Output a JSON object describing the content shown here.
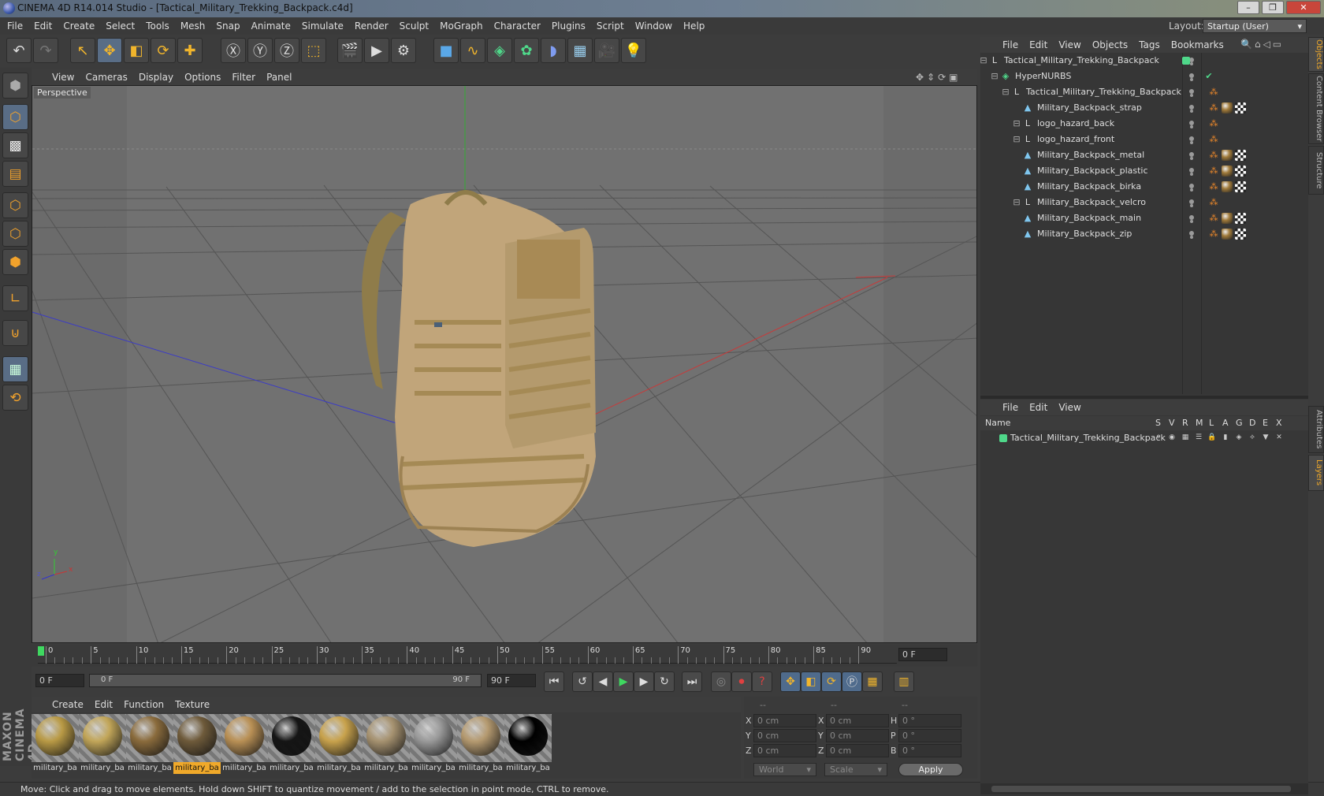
{
  "window": {
    "title": "CINEMA 4D R14.014 Studio - [Tactical_Military_Trekking_Backpack.c4d]",
    "layout_label": "Layout:",
    "layout_value": "Startup (User)"
  },
  "menubar": {
    "items": [
      "File",
      "Edit",
      "Create",
      "Select",
      "Tools",
      "Mesh",
      "Snap",
      "Animate",
      "Simulate",
      "Render",
      "Sculpt",
      "MoGraph",
      "Character",
      "Plugins",
      "Script",
      "Window",
      "Help"
    ]
  },
  "viewport": {
    "menu": [
      "View",
      "Cameras",
      "Display",
      "Options",
      "Filter",
      "Panel"
    ],
    "label": "Perspective",
    "axis_x": "x",
    "axis_y": "y",
    "axis_z": "z"
  },
  "timeline": {
    "ticks": [
      "0",
      "5",
      "10",
      "15",
      "20",
      "25",
      "30",
      "35",
      "40",
      "45",
      "50",
      "55",
      "60",
      "65",
      "70",
      "75",
      "80",
      "85",
      "90"
    ],
    "current_frame": "0 F",
    "start_field": "0 F",
    "range_start": "0 F",
    "range_end": "90 F",
    "end_field": "90 F"
  },
  "materials": {
    "menu": [
      "Create",
      "Edit",
      "Function",
      "Texture"
    ],
    "items": [
      {
        "label": "military_ba",
        "color": "#b99a45"
      },
      {
        "label": "military_ba",
        "color": "#c2a659"
      },
      {
        "label": "military_ba",
        "color": "#8a6b3c"
      },
      {
        "label": "military_ba",
        "color": "#6e5a3a"
      },
      {
        "label": "military_ba",
        "color": "#b99055"
      },
      {
        "label": "military_ba",
        "color": "#151515"
      },
      {
        "label": "military_ba",
        "color": "#c8a24c"
      },
      {
        "label": "military_ba",
        "color": "#a69270"
      },
      {
        "label": "military_ba",
        "color": "#9a9a9a"
      },
      {
        "label": "military_ba",
        "color": "#b59a70"
      },
      {
        "label": "military_ba",
        "color": "#000000"
      }
    ],
    "selected_index": 3
  },
  "coords": {
    "headers": [
      "--",
      "--",
      "--"
    ],
    "rows": [
      {
        "a": "X",
        "av": "0 cm",
        "b": "X",
        "bv": "0 cm",
        "c": "H",
        "cv": "0 °"
      },
      {
        "a": "Y",
        "av": "0 cm",
        "b": "Y",
        "bv": "0 cm",
        "c": "P",
        "cv": "0 °"
      },
      {
        "a": "Z",
        "av": "0 cm",
        "b": "Z",
        "bv": "0 cm",
        "c": "B",
        "cv": "0 °"
      }
    ],
    "mode1": "World",
    "mode2": "Scale",
    "apply": "Apply"
  },
  "objects_panel": {
    "menu": [
      "File",
      "Edit",
      "View",
      "Objects",
      "Tags",
      "Bookmarks"
    ],
    "rows": [
      {
        "name": "Tactical_Military_Trekking_Backpack",
        "icon": "null-icon",
        "level": 0
      },
      {
        "name": "HyperNURBS",
        "icon": "hypernurbs-icon",
        "level": 1
      },
      {
        "name": "Tactical_Military_Trekking_Backpack",
        "icon": "null-icon",
        "level": 2
      },
      {
        "name": "Military_Backpack_strap",
        "icon": "polygon-icon",
        "level": 3
      },
      {
        "name": "logo_hazard_back",
        "icon": "null-icon",
        "level": 3
      },
      {
        "name": "logo_hazard_front",
        "icon": "null-icon",
        "level": 3
      },
      {
        "name": "Military_Backpack_metal",
        "icon": "polygon-icon",
        "level": 3
      },
      {
        "name": "Military_Backpack_plastic",
        "icon": "polygon-icon",
        "level": 3
      },
      {
        "name": "Military_Backpack_birka",
        "icon": "polygon-icon",
        "level": 3
      },
      {
        "name": "Military_Backpack_velcro",
        "icon": "null-icon",
        "level": 3
      },
      {
        "name": "Military_Backpack_main",
        "icon": "polygon-icon",
        "level": 3
      },
      {
        "name": "Military_Backpack_zip",
        "icon": "polygon-icon",
        "level": 3
      }
    ]
  },
  "layers_panel": {
    "menu": [
      "File",
      "Edit",
      "View"
    ],
    "header_name": "Name",
    "header_cols": [
      "S",
      "V",
      "R",
      "M",
      "L",
      "A",
      "G",
      "D",
      "E",
      "X"
    ],
    "rows": [
      {
        "name": "Tactical_Military_Trekking_Backpack",
        "color": "#4fd88a"
      }
    ]
  },
  "side_tabs": [
    "Objects",
    "Content Browser",
    "Structure",
    "Attributes",
    "Layers"
  ],
  "status": "Move: Click and drag to move elements. Hold down SHIFT to quantize movement / add to the selection in point mode, CTRL to remove.",
  "brand": "MAXON CINEMA 4D",
  "colors": {
    "accent": "#f0a92a",
    "selection": "#596d86",
    "viewport_bg": "#6c6c6c"
  }
}
